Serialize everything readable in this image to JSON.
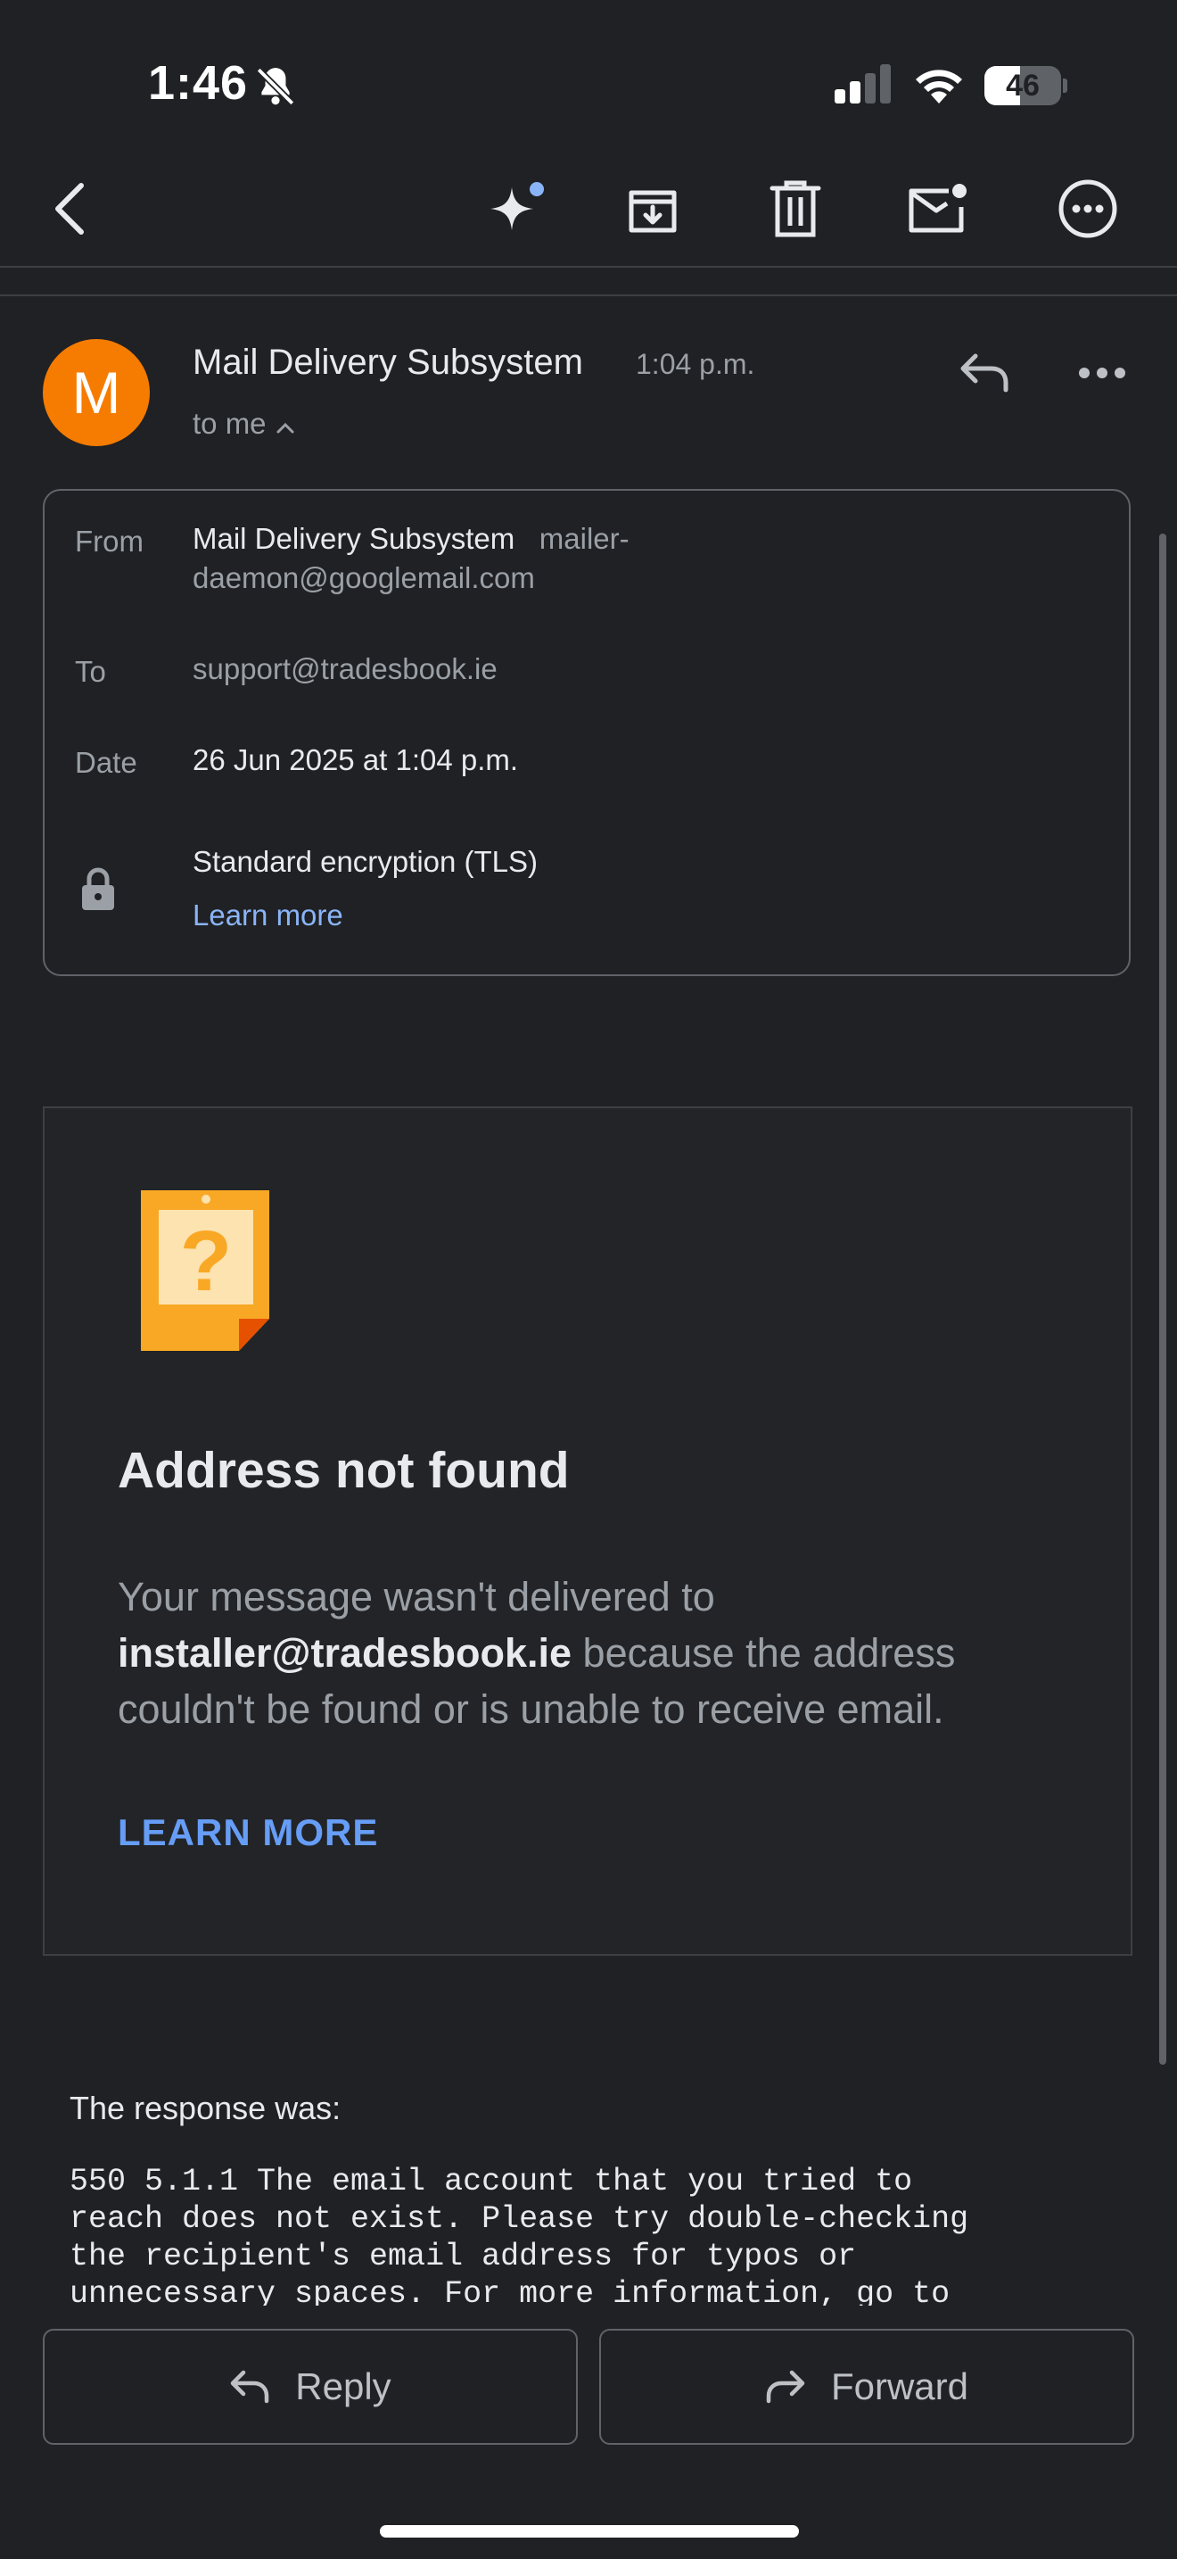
{
  "status_bar": {
    "time": "1:46",
    "battery": "46",
    "battery_level": 0.46
  },
  "icons": {
    "silent": "bell-slash-icon",
    "signal": "cellular-signal-icon",
    "wifi": "wifi-icon",
    "back": "chevron-left-icon",
    "ai": "sparkle-icon",
    "archive": "archive-icon",
    "delete": "trash-icon",
    "mark_unread": "mark-unread-icon",
    "more": "more-circle-icon",
    "reply": "reply-icon",
    "more_h": "more-horizontal-icon",
    "lock": "lock-icon",
    "warning_doc": "question-note-icon",
    "forward": "forward-icon"
  },
  "email": {
    "avatar_letter": "M",
    "sender": "Mail Delivery Subsystem",
    "time": "1:04 p.m.",
    "to_me": "to me",
    "details": {
      "from_label": "From",
      "from_name": "Mail Delivery Subsystem",
      "from_address_line1": "mailer-",
      "from_address_line2": "daemon@googlemail.com",
      "to_label": "To",
      "to_value": "support@tradesbook.ie",
      "date_label": "Date",
      "date_value": "26 Jun 2025 at 1:04 p.m.",
      "encryption": "Standard encryption (TLS)",
      "learn_more": "Learn more"
    },
    "card": {
      "title": "Address not found",
      "body_pre": "Your message wasn't delivered to",
      "address": "installer@tradesbook.ie",
      "body_post": " because the address couldn't be found or is unable to receive email.",
      "link": "LEARN MORE"
    },
    "response_label": "The response was:",
    "response_text": "550 5.1.1 The email account that you tried to\nreach does not exist. Please try double-checking\nthe recipient's email address for typos or\nunnecessary spaces. For more information, go to"
  },
  "actions": {
    "reply": "Reply",
    "forward": "Forward"
  },
  "colors": {
    "background": "#202124",
    "avatar": "#f57c00",
    "link": "#8ab4f8",
    "card_link": "#669df6",
    "note": "#f9a825"
  }
}
